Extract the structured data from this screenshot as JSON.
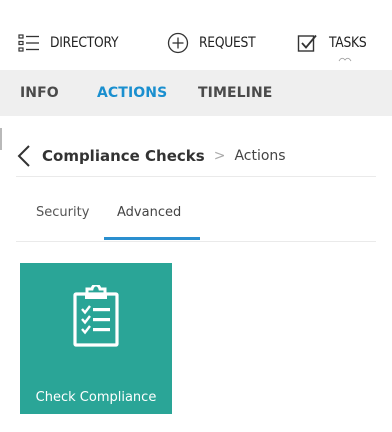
{
  "topnav": {
    "directory_label": "DIRECTORY",
    "request_label": "REQUEST",
    "tasks_label": "TASKS"
  },
  "tabs": [
    {
      "label": "INFO",
      "active": false
    },
    {
      "label": "ACTIONS",
      "active": true
    },
    {
      "label": "TIMELINE",
      "active": false
    }
  ],
  "breadcrumb": {
    "title": "Compliance Checks",
    "separator": ">",
    "current": "Actions"
  },
  "subtabs": [
    {
      "label": "Security",
      "active": false
    },
    {
      "label": "Advanced",
      "active": true
    }
  ],
  "tiles": [
    {
      "label": "Check Compliance",
      "icon": "clipboard-checklist-icon",
      "color": "#2aa597"
    }
  ],
  "colors": {
    "accent": "#1a8fcf",
    "tab_bar_bg": "#efefef",
    "tile_bg": "#2aa597"
  }
}
